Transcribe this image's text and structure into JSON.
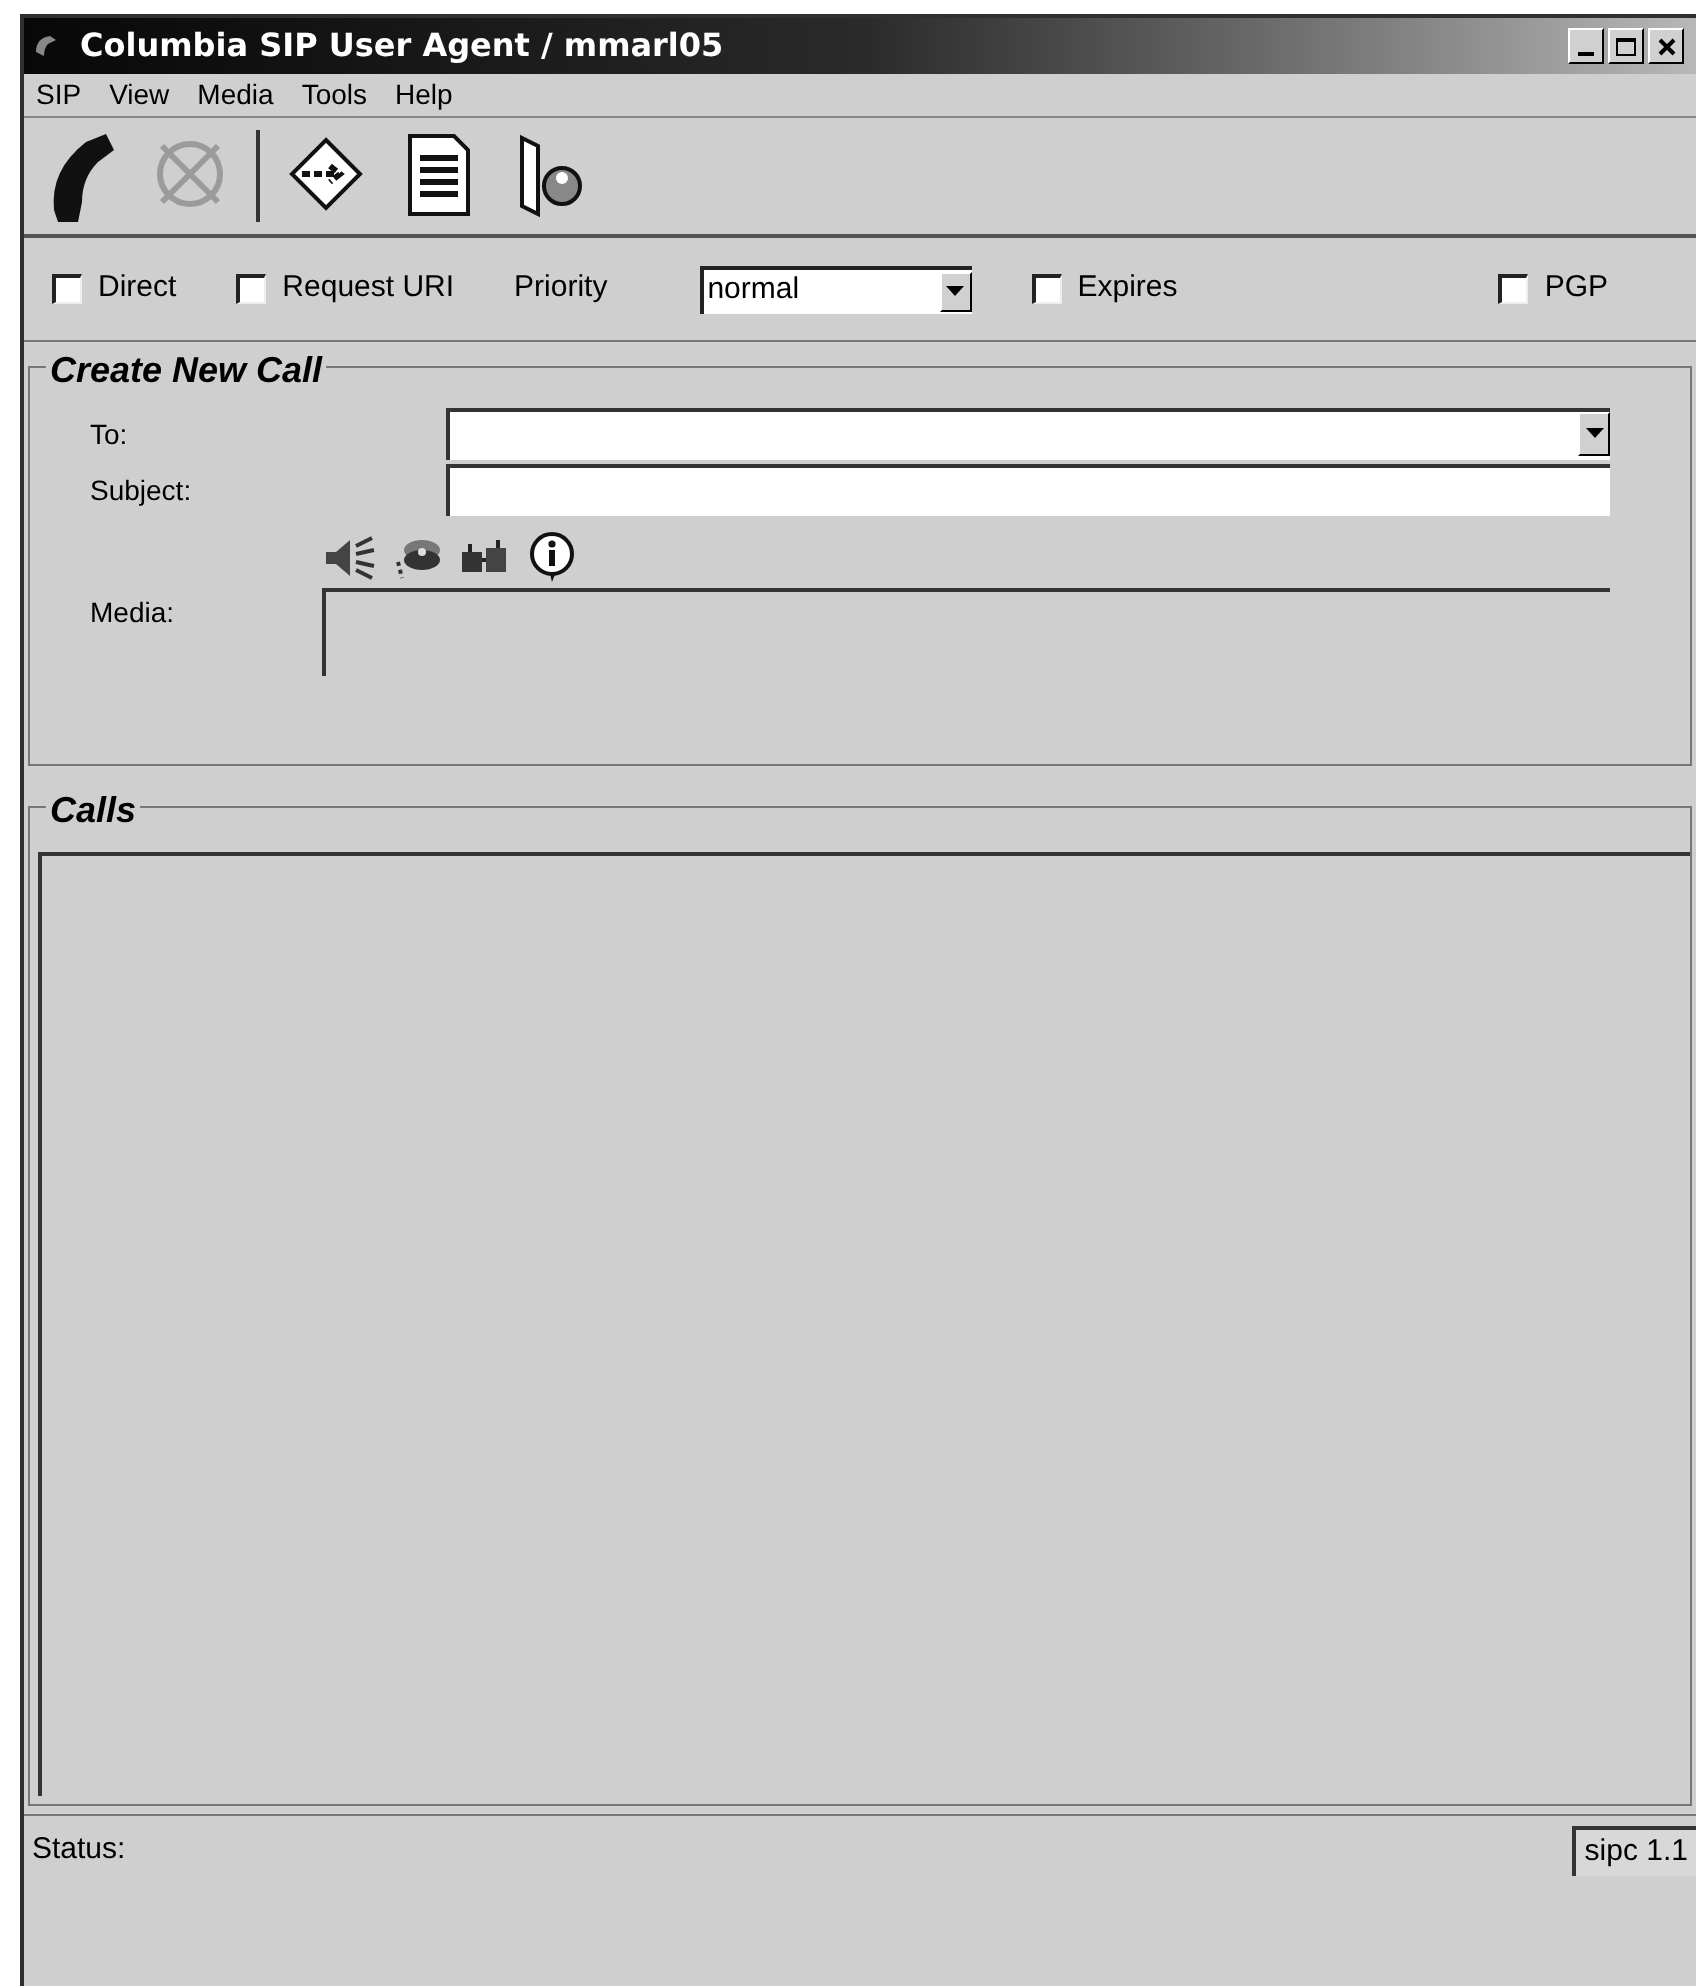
{
  "window": {
    "title": "Columbia SIP User Agent / mmarl05"
  },
  "menu": [
    "SIP",
    "View",
    "Media",
    "Tools",
    "Help"
  ],
  "toolbar": [
    {
      "disabled": false
    },
    {
      "disabled": true
    },
    {
      "disabled": false
    },
    {
      "disabled": false
    },
    {
      "disabled": false
    }
  ],
  "options": [
    {
      "kind": "checkbox",
      "label": "Direct",
      "checked": false
    },
    {
      "kind": "checkbox",
      "label": "Request URI",
      "checked": false
    },
    {
      "kind": "select",
      "label": "Priority",
      "value": "normal"
    },
    {
      "kind": "checkbox",
      "label": "Expires",
      "checked": false
    },
    {
      "kind": "checkbox",
      "label": "PGP",
      "checked": false
    }
  ],
  "create_new_call": {
    "title": "Create New Call",
    "to_label": "To:",
    "subject_label": "Subject:",
    "media_label": "Media:"
  },
  "calls": {
    "title": "Calls"
  },
  "status_bar": {
    "label": "Status:",
    "version": "sipc 1.1"
  }
}
